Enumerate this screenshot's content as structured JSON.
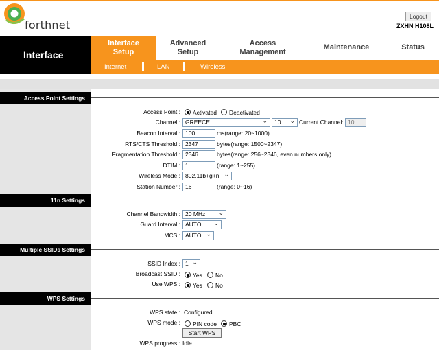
{
  "header": {
    "brand": "forthnet",
    "logout_label": "Logout",
    "model": "ZXHN H108L"
  },
  "nav": {
    "section_title": "Interface",
    "tabs": [
      {
        "label": "Interface\nSetup"
      },
      {
        "label": "Advanced\nSetup"
      },
      {
        "label": "Access\nManagement"
      },
      {
        "label": "Maintenance"
      },
      {
        "label": "Status"
      }
    ],
    "subtabs": [
      "Internet",
      "LAN",
      "Wireless"
    ]
  },
  "sections": {
    "access_point": "Access Point Settings",
    "n11": "11n Settings",
    "multi_ssid": "Multiple SSIDs Settings",
    "wps": "WPS Settings"
  },
  "access_point": {
    "access_point_label": "Access Point :",
    "activated": "Activated",
    "deactivated": "Deactivated",
    "channel_label": "Channel :",
    "channel_country": "GREECE",
    "channel_value": "10",
    "current_channel_label": "Current Channel:",
    "current_channel_value": "10",
    "beacon_label": "Beacon Interval :",
    "beacon_value": "100",
    "beacon_hint": "ms(range: 20~1000)",
    "rts_label": "RTS/CTS Threshold :",
    "rts_value": "2347",
    "rts_hint": "bytes(range: 1500~2347)",
    "frag_label": "Fragmentation Threshold :",
    "frag_value": "2346",
    "frag_hint": "bytes(range: 256~2346, even numbers only)",
    "dtim_label": "DTIM :",
    "dtim_value": "1",
    "dtim_hint": "(range: 1~255)",
    "mode_label": "Wireless Mode :",
    "mode_value": "802.11b+g+n",
    "station_label": "Station Number :",
    "station_value": "16",
    "station_hint": "(range: 0~16)"
  },
  "n11": {
    "bw_label": "Channel Bandwidth :",
    "bw_value": "20 MHz",
    "guard_label": "Guard Interval :",
    "guard_value": "AUTO",
    "mcs_label": "MCS :",
    "mcs_value": "AUTO"
  },
  "multi_ssid": {
    "index_label": "SSID Index :",
    "index_value": "1",
    "broadcast_label": "Broadcast SSID :",
    "yes": "Yes",
    "no": "No",
    "wps_label": "Use WPS :"
  },
  "wps": {
    "state_label": "WPS state :",
    "state_value": "Configured",
    "mode_label": "WPS mode :",
    "pin_code": "PIN code",
    "pbc": "PBC",
    "start_label": "Start WPS",
    "progress_label": "WPS progress :",
    "progress_value": "Idle"
  },
  "colors": {
    "accent": "#f7941d",
    "black": "#000000",
    "panel_gray": "#e5e5e5"
  }
}
